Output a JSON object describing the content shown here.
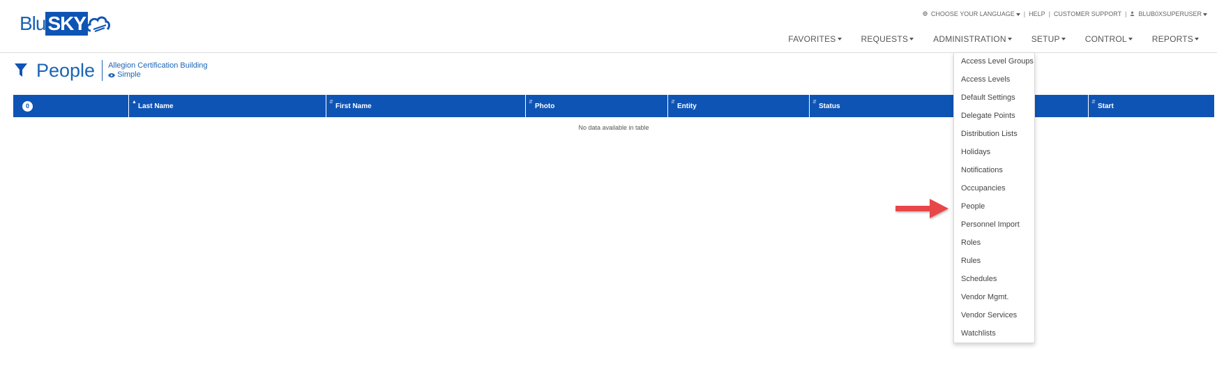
{
  "brand": {
    "part1": "Blu",
    "part2": "SKY"
  },
  "utility": {
    "language": "CHOOSE YOUR LANGUAGE",
    "help": "HELP",
    "support": "CUSTOMER SUPPORT",
    "user": "BLUB0XSUPERUSER",
    "separator": "|"
  },
  "nav": [
    "FAVORITES",
    "REQUESTS",
    "ADMINISTRATION",
    "SETUP",
    "CONTROL",
    "REPORTS"
  ],
  "page": {
    "title": "People",
    "building": "Allegion Certification Building",
    "view": "Simple"
  },
  "table": {
    "count": "0",
    "columns": [
      "Last Name",
      "First Name",
      "Photo",
      "Entity",
      "Status",
      "",
      "Start"
    ],
    "empty_message": "No data available in table"
  },
  "admin_menu": [
    "Access Level Groups",
    "Access Levels",
    "Default Settings",
    "Delegate Points",
    "Distribution Lists",
    "Holidays",
    "Notifications",
    "Occupancies",
    "People",
    "Personnel Import",
    "Roles",
    "Rules",
    "Schedules",
    "Vendor Mgmt.",
    "Vendor Services",
    "Watchlists"
  ],
  "colors": {
    "brand_blue": "#0e54b5",
    "text_blue": "#1a64b4",
    "arrow_red": "#e8474a"
  },
  "icons": {
    "filter": "filter-icon",
    "eye": "eye-icon",
    "globe": "globe-icon",
    "user": "user-icon",
    "arrow": "red-arrow-icon"
  }
}
